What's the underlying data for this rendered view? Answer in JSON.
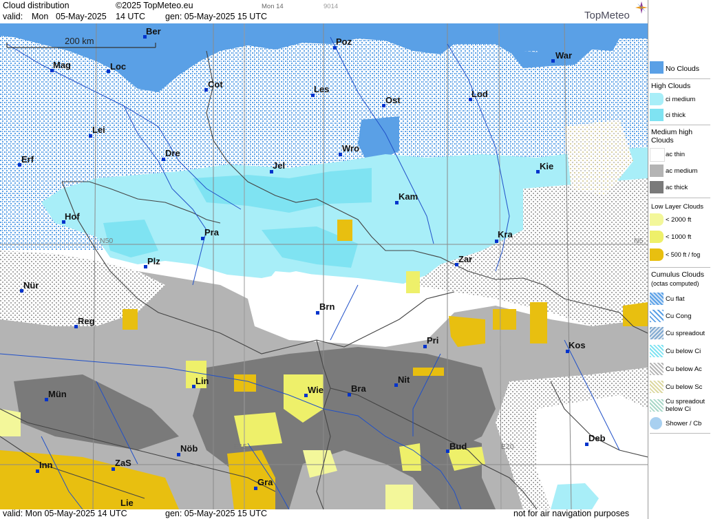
{
  "header": {
    "title": "Cloud distribution",
    "copyright": "©2025 TopMeteo.eu",
    "valid_label": "valid:",
    "valid_day": "Mon",
    "valid_date": "05-May-2025",
    "valid_time": "14 UTC",
    "gen_text": "gen: 05-May-2025 15 UTC",
    "small_day": "Mon 14",
    "small_code": "9014"
  },
  "brand": "TopMeteo",
  "scale_label": "200 km",
  "footer": {
    "valid_text": "valid:  Mon  05-May-2025  14 UTC",
    "gen_text": "gen: 05-May-2025 15 UTC",
    "disclaimer": "not for air navigation purposes"
  },
  "coords": [
    "N50",
    "N5",
    "E15",
    "E20"
  ],
  "cities": [
    {
      "name": "Ber"
    },
    {
      "name": "Poz"
    },
    {
      "name": "War"
    },
    {
      "name": "Mag"
    },
    {
      "name": "Loc"
    },
    {
      "name": "Cot"
    },
    {
      "name": "Les"
    },
    {
      "name": "Ost"
    },
    {
      "name": "Lod"
    },
    {
      "name": "Lei"
    },
    {
      "name": "Erf"
    },
    {
      "name": "Dre"
    },
    {
      "name": "Wro"
    },
    {
      "name": "Jel"
    },
    {
      "name": "Kie"
    },
    {
      "name": "Kam"
    },
    {
      "name": "Hof"
    },
    {
      "name": "Pra"
    },
    {
      "name": "Kra"
    },
    {
      "name": "Plz"
    },
    {
      "name": "Zar"
    },
    {
      "name": "Nür"
    },
    {
      "name": "Brn"
    },
    {
      "name": "Reg"
    },
    {
      "name": "Pri"
    },
    {
      "name": "Kos"
    },
    {
      "name": "Lin"
    },
    {
      "name": "Nit"
    },
    {
      "name": "Wie"
    },
    {
      "name": "Bra"
    },
    {
      "name": "Mün"
    },
    {
      "name": "Nöb"
    },
    {
      "name": "Deb"
    },
    {
      "name": "Bud"
    },
    {
      "name": "Inn"
    },
    {
      "name": "ZaS"
    },
    {
      "name": "Gra"
    },
    {
      "name": "Lie"
    }
  ],
  "legend": {
    "no_clouds": "No Clouds",
    "high_title": "High Clouds",
    "ci_medium": "ci medium",
    "ci_thick": "ci thick",
    "mid_title_1": "Medium high",
    "mid_title_2": "Clouds",
    "ac_thin": "ac thin",
    "ac_medium": "ac medium",
    "ac_thick": "ac thick",
    "low_title": "Low Layer Clouds",
    "low_2000": "< 2000 ft",
    "low_1000": "< 1000 ft",
    "low_500": "< 500 ft / fog",
    "cu_title": "Cumulus Clouds",
    "cu_sub": "(octas computed)",
    "cu_flat": "Cu flat",
    "cu_cong": "Cu Cong",
    "cu_spread": "Cu spreadout",
    "cu_below_ci": "Cu below Ci",
    "cu_below_ac": "Cu below Ac",
    "cu_below_sc": "Cu below Sc",
    "cu_spread_ci_1": "Cu spreadout",
    "cu_spread_ci_2": "below Ci",
    "shower": "Shower / Cb"
  },
  "colors": {
    "no_clouds": "#5aa0e6",
    "ci_medium": "#a8eef8",
    "ci_thick": "#7fe3f2",
    "ac_thin": "#ffffff",
    "ac_medium": "#b4b4b4",
    "ac_thick": "#7a7a7a",
    "low_2000": "#f3f79a",
    "low_1000": "#eef06a",
    "low_500": "#e8bf10",
    "river": "#2050c8",
    "border": "#444444",
    "grid": "#8a8a8a"
  }
}
